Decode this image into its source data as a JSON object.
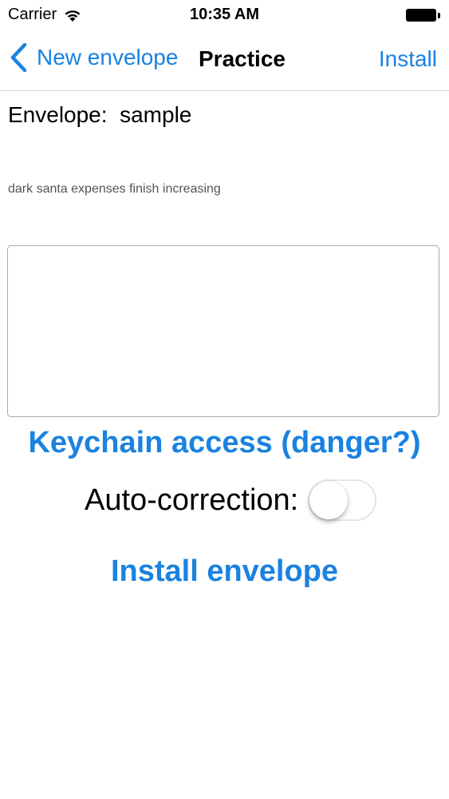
{
  "status_bar": {
    "carrier": "Carrier",
    "time": "10:35 AM"
  },
  "nav": {
    "back_label": "New envelope",
    "title": "Practice",
    "right_label": "Install"
  },
  "envelope": {
    "label": "Envelope:",
    "value": "sample",
    "hint": "dark santa expenses finish increasing",
    "text_value": ""
  },
  "actions": {
    "keychain_label": "Keychain access (danger?)",
    "autocorrect_label": "Auto-correction:",
    "autocorrect_on": false,
    "install_label": "Install envelope"
  },
  "colors": {
    "accent": "#1a82e0",
    "text": "#000000",
    "hint": "#555555",
    "border": "#a8a8a8"
  },
  "icons": {
    "wifi": "wifi-icon",
    "battery": "battery-icon",
    "back": "chevron-left-icon"
  }
}
